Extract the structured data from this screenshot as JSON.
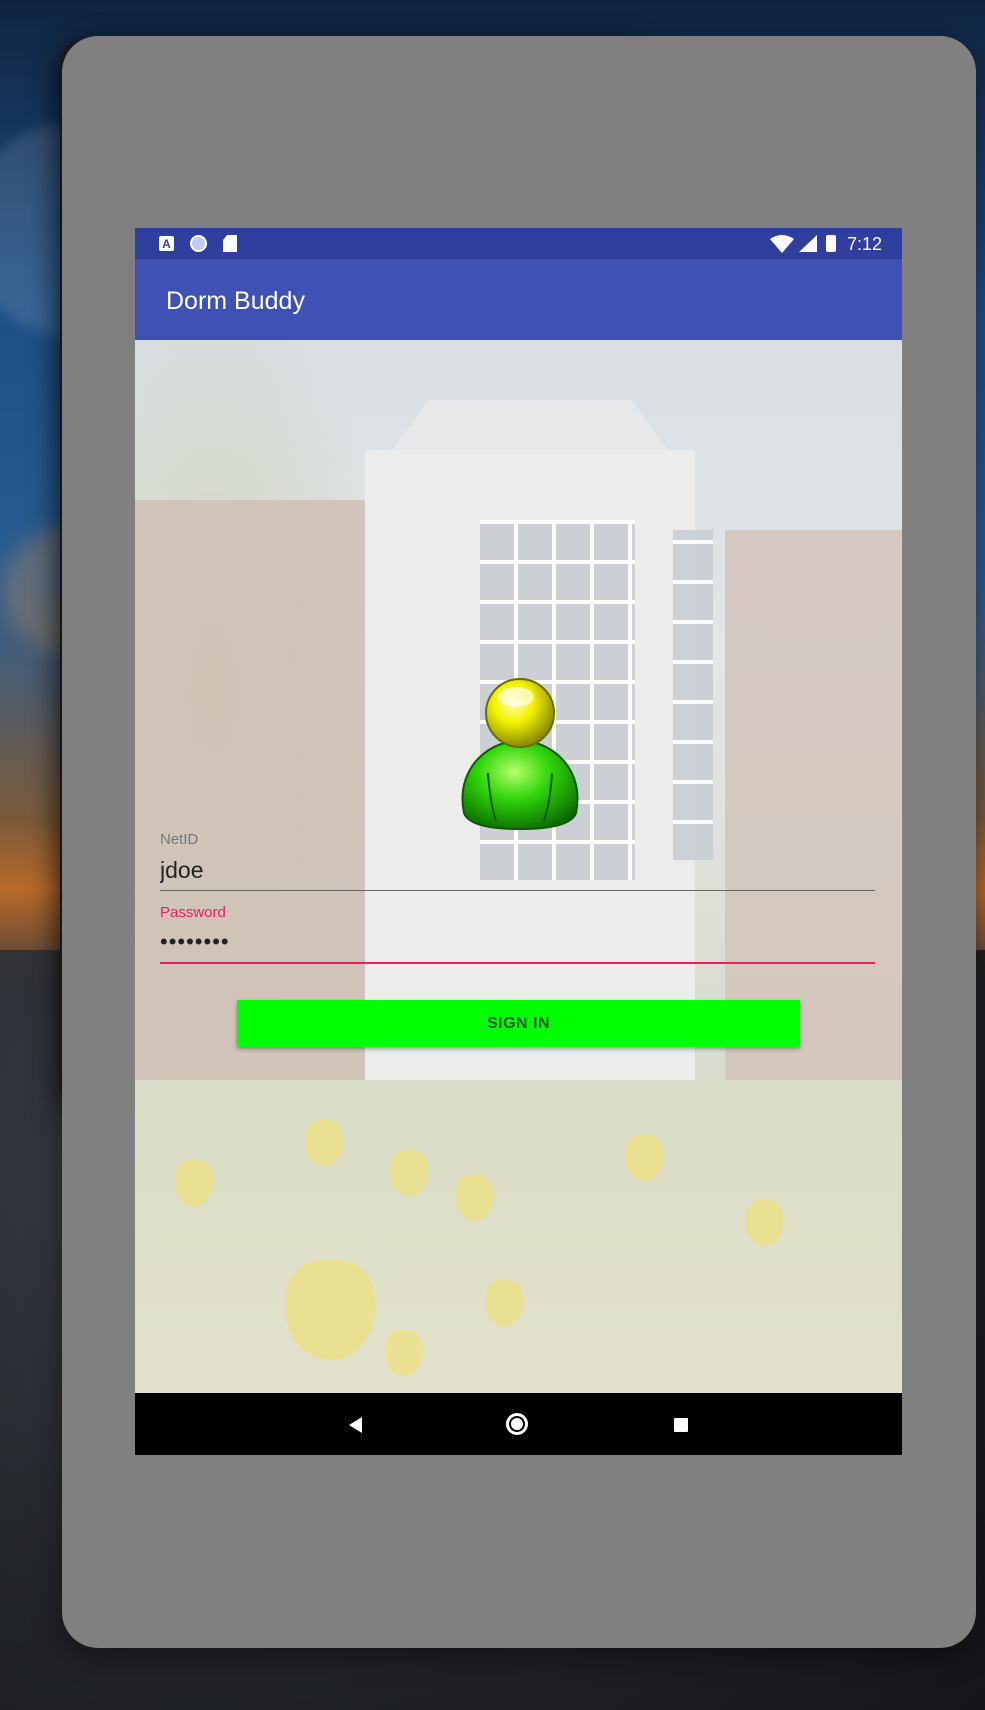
{
  "status_bar": {
    "notification_icons": [
      "app-a-icon",
      "circle-icon",
      "sd-card-icon"
    ],
    "a_glyph": "A",
    "wifi_icon": "wifi-icon",
    "signal_icon": "signal-icon",
    "battery_icon": "battery-charging-icon",
    "time": "7:12"
  },
  "app_bar": {
    "title": "Dorm Buddy"
  },
  "form": {
    "netid_label": "NetID",
    "netid_value": "jdoe",
    "password_label": "Password",
    "password_value": "••••••••",
    "signin_label": "SIGN IN"
  },
  "nav_bar": {
    "buttons": [
      "back-icon",
      "home-icon",
      "recent-apps-icon"
    ]
  },
  "colors": {
    "status_bar": "#303f9f",
    "app_bar": "#3f51b5",
    "accent": "#e91e63",
    "signin_button": "#00ff00",
    "back_screen": "#0597d2",
    "device_frame": "#808080"
  }
}
